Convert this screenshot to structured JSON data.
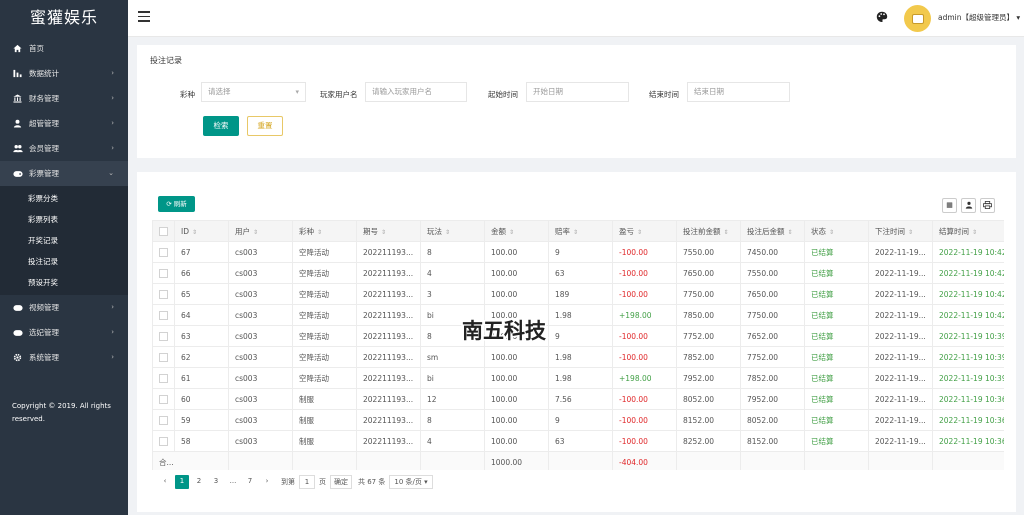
{
  "sidebar": {
    "logo": "蜜獾娱乐",
    "items": [
      {
        "label": "首页",
        "icon": "home-icon",
        "arrow": ""
      },
      {
        "label": "数据统计",
        "icon": "bar-chart-icon",
        "arrow": "›"
      },
      {
        "label": "财务管理",
        "icon": "bank-icon",
        "arrow": "›"
      },
      {
        "label": "超管管理",
        "icon": "user-icon",
        "arrow": "›"
      },
      {
        "label": "会员管理",
        "icon": "users-icon",
        "arrow": "›"
      },
      {
        "label": "彩票管理",
        "icon": "gamepad-icon",
        "arrow": "⌄"
      }
    ],
    "sub_items": [
      "彩票分类",
      "彩票列表",
      "开奖记录",
      "投注记录",
      "预设开奖"
    ],
    "items_after": [
      {
        "label": "视频管理",
        "icon": "video-icon",
        "arrow": "›"
      },
      {
        "label": "选妃管理",
        "icon": "tag-icon",
        "arrow": "›"
      },
      {
        "label": "系统管理",
        "icon": "gear-icon",
        "arrow": "›"
      }
    ],
    "copyright": "Copyright © 2019. All rights reserved."
  },
  "header": {
    "user": "admin【超级管理员】",
    "user_caret": "▾"
  },
  "search": {
    "title": "投注记录",
    "lottery_label": "彩种",
    "lottery_placeholder": "请选择",
    "player_label": "玩家用户名",
    "player_placeholder": "请输入玩家用户名",
    "start_label": "起始时间",
    "start_placeholder": "开始日期",
    "end_label": "结束时间",
    "end_placeholder": "结束日期",
    "search_btn": "检索",
    "reset_btn": "重置"
  },
  "table": {
    "refresh": "⟳ 刷新",
    "columns": [
      "ID",
      "用户",
      "彩种",
      "期号",
      "玩法",
      "金额",
      "赔率",
      "盈亏",
      "投注前金额",
      "投注后金额",
      "状态",
      "下注时间",
      "结算时间"
    ],
    "rows": [
      {
        "id": "67",
        "user": "cs003",
        "game": "空降活动",
        "issue": "202211193...",
        "play": "8",
        "amount": "100.00",
        "odds": "9",
        "profit": "-100.00",
        "before": "7550.00",
        "after": "7450.00",
        "status": "已结算",
        "bet_time": "2022-11-19...",
        "settle_time": "2022-11-19 10:42"
      },
      {
        "id": "66",
        "user": "cs003",
        "game": "空降活动",
        "issue": "202211193...",
        "play": "4",
        "amount": "100.00",
        "odds": "63",
        "profit": "-100.00",
        "before": "7650.00",
        "after": "7550.00",
        "status": "已结算",
        "bet_time": "2022-11-19...",
        "settle_time": "2022-11-19 10:42"
      },
      {
        "id": "65",
        "user": "cs003",
        "game": "空降活动",
        "issue": "202211193...",
        "play": "3",
        "amount": "100.00",
        "odds": "189",
        "profit": "-100.00",
        "before": "7750.00",
        "after": "7650.00",
        "status": "已结算",
        "bet_time": "2022-11-19...",
        "settle_time": "2022-11-19 10:42"
      },
      {
        "id": "64",
        "user": "cs003",
        "game": "空降活动",
        "issue": "202211193...",
        "play": "bi",
        "amount": "100.00",
        "odds": "1.98",
        "profit": "+198.00",
        "before": "7850.00",
        "after": "7750.00",
        "status": "已结算",
        "bet_time": "2022-11-19...",
        "settle_time": "2022-11-19 10:42"
      },
      {
        "id": "63",
        "user": "cs003",
        "game": "空降活动",
        "issue": "202211193...",
        "play": "8",
        "amount": "100.00",
        "odds": "9",
        "profit": "-100.00",
        "before": "7752.00",
        "after": "7652.00",
        "status": "已结算",
        "bet_time": "2022-11-19...",
        "settle_time": "2022-11-19 10:39"
      },
      {
        "id": "62",
        "user": "cs003",
        "game": "空降活动",
        "issue": "202211193...",
        "play": "sm",
        "amount": "100.00",
        "odds": "1.98",
        "profit": "-100.00",
        "before": "7852.00",
        "after": "7752.00",
        "status": "已结算",
        "bet_time": "2022-11-19...",
        "settle_time": "2022-11-19 10:39"
      },
      {
        "id": "61",
        "user": "cs003",
        "game": "空降活动",
        "issue": "202211193...",
        "play": "bi",
        "amount": "100.00",
        "odds": "1.98",
        "profit": "+198.00",
        "before": "7952.00",
        "after": "7852.00",
        "status": "已结算",
        "bet_time": "2022-11-19...",
        "settle_time": "2022-11-19 10:39"
      },
      {
        "id": "60",
        "user": "cs003",
        "game": "制服",
        "issue": "202211193...",
        "play": "12",
        "amount": "100.00",
        "odds": "7.56",
        "profit": "-100.00",
        "before": "8052.00",
        "after": "7952.00",
        "status": "已结算",
        "bet_time": "2022-11-19...",
        "settle_time": "2022-11-19 10:36"
      },
      {
        "id": "59",
        "user": "cs003",
        "game": "制服",
        "issue": "202211193...",
        "play": "8",
        "amount": "100.00",
        "odds": "9",
        "profit": "-100.00",
        "before": "8152.00",
        "after": "8052.00",
        "status": "已结算",
        "bet_time": "2022-11-19...",
        "settle_time": "2022-11-19 10:36"
      },
      {
        "id": "58",
        "user": "cs003",
        "game": "制服",
        "issue": "202211193...",
        "play": "4",
        "amount": "100.00",
        "odds": "63",
        "profit": "-100.00",
        "before": "8252.00",
        "after": "8152.00",
        "status": "已结算",
        "bet_time": "2022-11-19...",
        "settle_time": "2022-11-19 10:36"
      }
    ],
    "total_label": "合...",
    "total_amount": "1000.00",
    "total_profit": "-404.00"
  },
  "pager": {
    "prev": "‹",
    "pages": [
      "1",
      "2",
      "3"
    ],
    "ellipsis": "...",
    "last": "7",
    "next": "›",
    "goto_label": "到第",
    "goto_value": "1",
    "page_unit": "页",
    "confirm": "确定",
    "total": "共 67 条",
    "per_page": "10 条/页"
  },
  "watermark": {
    "text": "南五科技"
  },
  "colors": {
    "sidebar_bg": "#2a3542",
    "primary": "#009688",
    "loss": "#e0292b",
    "profit": "#43a047"
  }
}
